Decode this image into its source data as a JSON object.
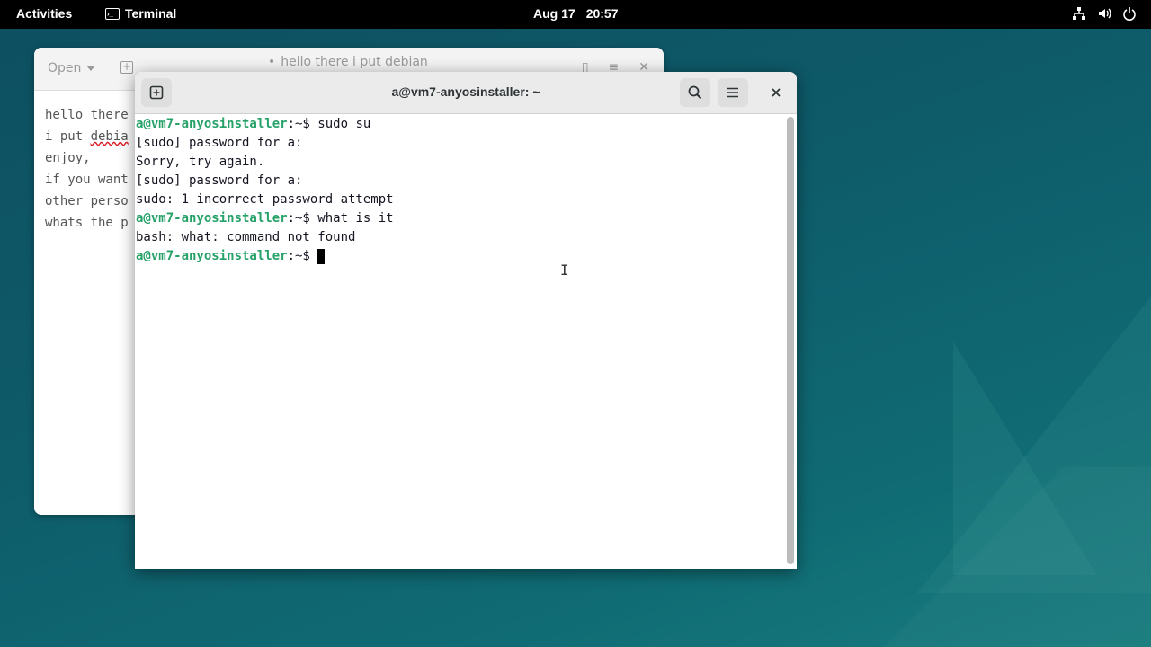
{
  "topbar": {
    "activities": "Activities",
    "app_name": "Terminal",
    "date": "Aug 17",
    "time": "20:57",
    "tray_icons": [
      "network-icon",
      "volume-icon",
      "power-icon"
    ]
  },
  "editor": {
    "open_label": "Open",
    "title": "hello there i put debian",
    "modified_dot": "•",
    "lines": [
      {
        "pre": "hello there",
        "spell": "",
        "post": ""
      },
      {
        "pre": "i put ",
        "spell": "debia",
        "post": ""
      },
      {
        "pre": "enjoy,",
        "spell": "",
        "post": ""
      },
      {
        "pre": "if you want",
        "spell": "",
        "post": ""
      },
      {
        "pre": "other perso",
        "spell": "",
        "post": ""
      },
      {
        "pre": "whats the p",
        "spell": "",
        "post": ""
      }
    ]
  },
  "terminal": {
    "title": "a@vm7-anyosinstaller: ~",
    "prompt_user_host": "a@vm7-anyosinstaller",
    "prompt_suffix": ":~$ ",
    "lines": [
      {
        "prompt": true,
        "text": "sudo su"
      },
      {
        "prompt": false,
        "text": "[sudo] password for a:"
      },
      {
        "prompt": false,
        "text": "Sorry, try again."
      },
      {
        "prompt": false,
        "text": "[sudo] password for a:"
      },
      {
        "prompt": false,
        "text": "sudo: 1 incorrect password attempt"
      },
      {
        "prompt": true,
        "text": "what is it"
      },
      {
        "prompt": false,
        "text": "bash: what: command not found"
      },
      {
        "prompt": true,
        "text": "",
        "cursor": true
      }
    ]
  },
  "colors": {
    "prompt": "#26a269",
    "topbar": "#000000",
    "desktop": "#0f5c6b"
  }
}
